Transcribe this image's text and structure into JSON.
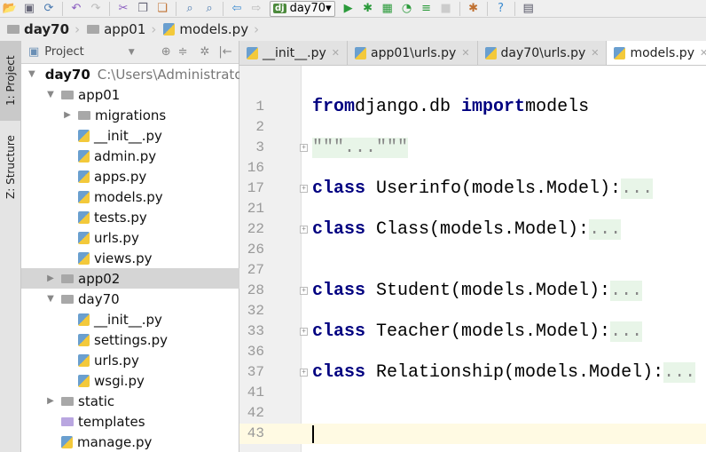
{
  "toolbar": {
    "icons": [
      "open-folder-icon",
      "save-icon",
      "sync-icon",
      "undo-icon",
      "redo-icon",
      "cut-icon",
      "copy-icon",
      "paste-icon",
      "find-icon",
      "replace-icon",
      "back-icon",
      "forward-icon",
      "run-icon",
      "debug-icon",
      "coverage-icon",
      "profile-icon",
      "concurrency-icon",
      "stop-icon",
      "settings-icon",
      "help-icon",
      "sdk-icon"
    ],
    "run_config": "day70"
  },
  "breadcrumb": [
    "day70",
    "app01",
    "models.py"
  ],
  "sidebar": {
    "strip": [
      "1: Project",
      "Z: Structure"
    ],
    "header": "Project",
    "tree": [
      {
        "label": "day70",
        "path": "C:\\Users\\Administrator\\",
        "depth": 0,
        "type": "folder",
        "expanded": true
      },
      {
        "label": "app01",
        "depth": 1,
        "type": "folder",
        "expanded": true
      },
      {
        "label": "migrations",
        "depth": 2,
        "type": "folder",
        "expanded": false
      },
      {
        "label": "__init__.py",
        "depth": 2,
        "type": "py"
      },
      {
        "label": "admin.py",
        "depth": 2,
        "type": "py"
      },
      {
        "label": "apps.py",
        "depth": 2,
        "type": "py"
      },
      {
        "label": "models.py",
        "depth": 2,
        "type": "py"
      },
      {
        "label": "tests.py",
        "depth": 2,
        "type": "py"
      },
      {
        "label": "urls.py",
        "depth": 2,
        "type": "py"
      },
      {
        "label": "views.py",
        "depth": 2,
        "type": "py"
      },
      {
        "label": "app02",
        "depth": 1,
        "type": "folder",
        "expanded": false,
        "selected": true
      },
      {
        "label": "day70",
        "depth": 1,
        "type": "folder",
        "expanded": true
      },
      {
        "label": "__init__.py",
        "depth": 2,
        "type": "py"
      },
      {
        "label": "settings.py",
        "depth": 2,
        "type": "py"
      },
      {
        "label": "urls.py",
        "depth": 2,
        "type": "py"
      },
      {
        "label": "wsgi.py",
        "depth": 2,
        "type": "py"
      },
      {
        "label": "static",
        "depth": 1,
        "type": "folder",
        "expanded": false
      },
      {
        "label": "templates",
        "depth": 1,
        "type": "folder-purple"
      },
      {
        "label": "manage.py",
        "depth": 1,
        "type": "py"
      }
    ]
  },
  "tabs": [
    {
      "label": "__init__.py",
      "active": false
    },
    {
      "label": "app01\\urls.py",
      "active": false
    },
    {
      "label": "day70\\urls.py",
      "active": false
    },
    {
      "label": "models.py",
      "active": true
    }
  ],
  "editor": {
    "lines": [
      {
        "n": "1",
        "parts": [
          [
            "kw",
            "from"
          ],
          [
            "",
            "django.db "
          ],
          [
            "kw",
            "import"
          ],
          [
            "",
            "models"
          ]
        ]
      },
      {
        "n": "2",
        "parts": []
      },
      {
        "n": "3",
        "fold": true,
        "parts": [
          [
            "folded",
            "\"\"\"...\"\"\""
          ]
        ]
      },
      {
        "n": "16",
        "parts": []
      },
      {
        "n": "17",
        "fold": true,
        "parts": [
          [
            "kw",
            "class"
          ],
          [
            "",
            " Userinfo(models.Model):"
          ],
          [
            "folded",
            "..."
          ]
        ]
      },
      {
        "n": "21",
        "parts": []
      },
      {
        "n": "22",
        "fold": true,
        "parts": [
          [
            "kw",
            "class"
          ],
          [
            "",
            " Class(models.Model):"
          ],
          [
            "folded",
            "..."
          ]
        ]
      },
      {
        "n": "26",
        "parts": []
      },
      {
        "n": "27",
        "parts": []
      },
      {
        "n": "28",
        "fold": true,
        "parts": [
          [
            "kw",
            "class"
          ],
          [
            "",
            " Student(models.Model):"
          ],
          [
            "folded",
            "..."
          ]
        ]
      },
      {
        "n": "32",
        "parts": []
      },
      {
        "n": "33",
        "fold": true,
        "parts": [
          [
            "kw",
            "class"
          ],
          [
            "",
            " Teacher(models.Model):"
          ],
          [
            "folded",
            "..."
          ]
        ]
      },
      {
        "n": "36",
        "parts": []
      },
      {
        "n": "37",
        "fold": true,
        "parts": [
          [
            "kw",
            "class"
          ],
          [
            "",
            " Relationship(models.Model):"
          ],
          [
            "folded",
            "..."
          ]
        ]
      },
      {
        "n": "41",
        "parts": []
      },
      {
        "n": "42",
        "parts": []
      },
      {
        "n": "43",
        "parts": [],
        "current": true
      }
    ]
  }
}
